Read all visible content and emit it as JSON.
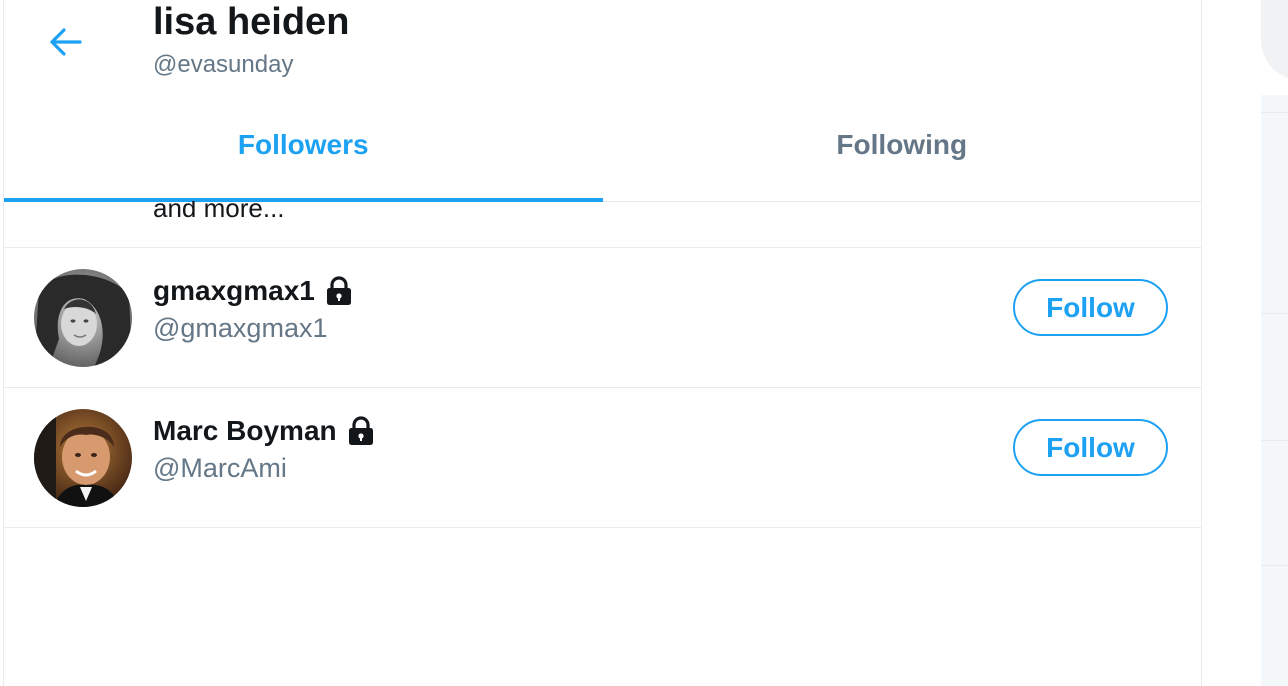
{
  "header": {
    "title": "lisa heiden",
    "handle": "@evasunday",
    "back_icon": "arrow-left-icon"
  },
  "tabs": [
    {
      "label": "Followers",
      "active": true
    },
    {
      "label": "Following",
      "active": false
    }
  ],
  "list": {
    "and_more": "and more..."
  },
  "users": [
    {
      "name": "gmaxgmax1",
      "handle": "@gmaxgmax1",
      "protected": true,
      "follow_label": "Follow"
    },
    {
      "name": "Marc Boyman",
      "handle": "@MarcAmi",
      "protected": true,
      "follow_label": "Follow"
    }
  ],
  "colors": {
    "accent": "#1da1f2",
    "text_primary": "#14171a",
    "text_secondary": "#657786",
    "border": "#e6ecf0"
  }
}
